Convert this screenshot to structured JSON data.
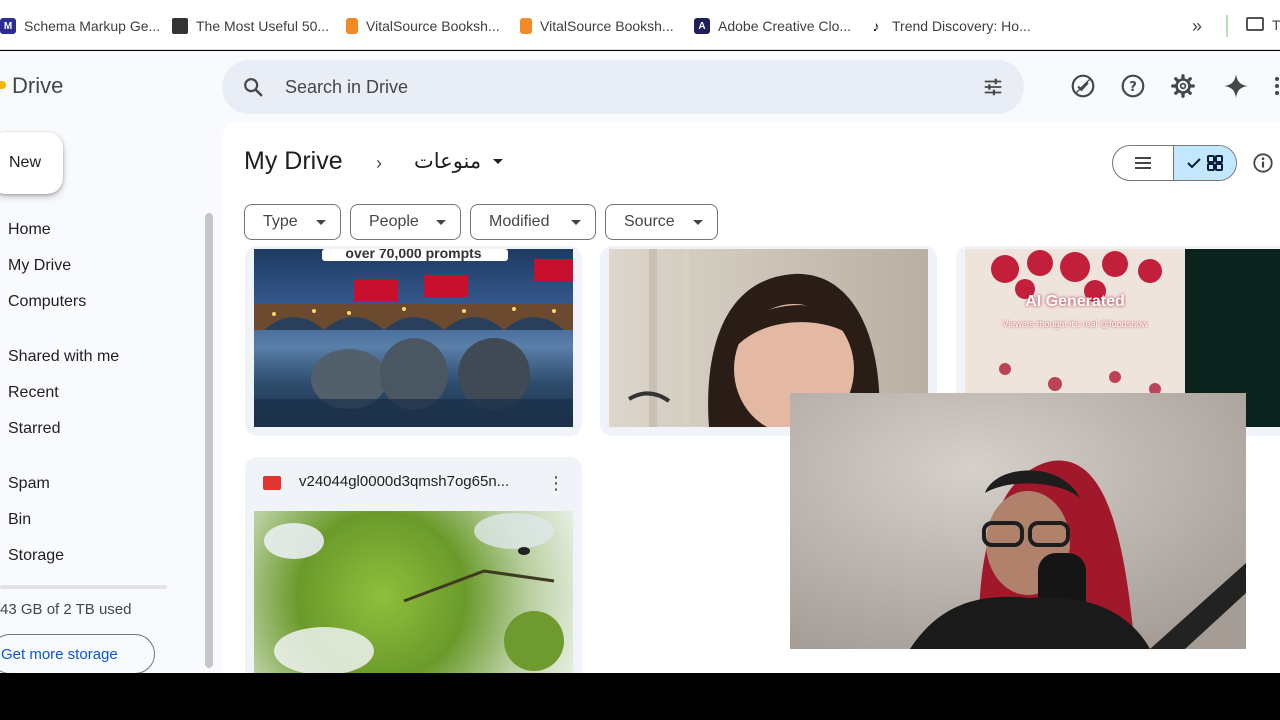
{
  "bookmarks": [
    {
      "label": "Schema Markup Ge...",
      "icon": "schema-icon",
      "color": "#2c2d8f"
    },
    {
      "label": "The Most Useful 50...",
      "icon": "page-icon",
      "color": "#333333"
    },
    {
      "label": "VitalSource Booksh...",
      "icon": "vitalsource-icon",
      "color": "#f28b25"
    },
    {
      "label": "VitalSource Booksh...",
      "icon": "vitalsource-icon",
      "color": "#f28b25"
    },
    {
      "label": "Adobe Creative Clo...",
      "icon": "adobe-icon",
      "color": "#1f1f5c"
    },
    {
      "label": "Trend Discovery: Ho...",
      "icon": "tiktok-icon",
      "color": "#000000"
    }
  ],
  "bookmarks_more": "»",
  "bookmarks_folder_label": "T",
  "app": {
    "name": "Drive",
    "search_placeholder": "Search in Drive"
  },
  "sidebar": {
    "new_label": "New",
    "items": [
      {
        "label": "Home"
      },
      {
        "label": "My Drive"
      },
      {
        "label": "Computers"
      },
      {
        "label": "Shared with me"
      },
      {
        "label": "Recent"
      },
      {
        "label": "Starred"
      },
      {
        "label": "Spam"
      },
      {
        "label": "Bin"
      },
      {
        "label": "Storage"
      }
    ],
    "storage_used": "43 GB of 2 TB used",
    "get_more_storage": "Get more storage"
  },
  "breadcrumb": {
    "root": "My Drive",
    "current": "منوعات"
  },
  "filters": [
    "Type",
    "People",
    "Modified",
    "Source"
  ],
  "files": [
    {
      "thumb_caption": "over 70,000 prompts"
    },
    {
      "thumb_caption": ""
    },
    {
      "thumb_caption": "AI Generated",
      "thumb_subcaption": "Viewers thought it's real @foodshow"
    },
    {
      "name": "v24044gl0000d3qmsh7og65n...",
      "type": "video"
    }
  ],
  "colors": {
    "accent": "#0b57d0",
    "selected_toggle": "#c2e7ff",
    "search_bg": "#e9eef6",
    "app_bg": "#f8fafd"
  }
}
